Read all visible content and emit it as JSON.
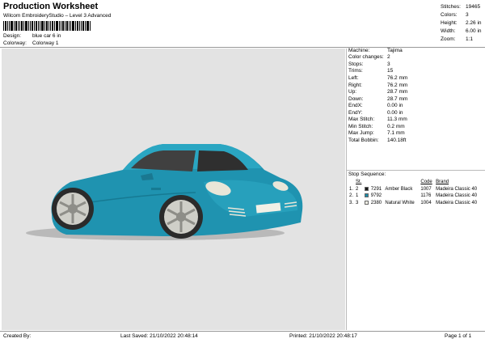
{
  "header": {
    "title": "Production Worksheet",
    "subtitle": "Wilcom EmbroideryStudio – Level 3 Advanced",
    "design_label": "Design:",
    "design_value": "blue car 6 in",
    "colorway_label": "Colorway:",
    "colorway_value": "Colorway 1"
  },
  "top_stats": [
    {
      "label": "Stitches:",
      "value": "19465"
    },
    {
      "label": "Colors:",
      "value": "3"
    },
    {
      "label": "Height:",
      "value": "2.26 in"
    },
    {
      "label": "Width:",
      "value": "6.00 in"
    },
    {
      "label": "Zoom:",
      "value": "1:1"
    }
  ],
  "details": [
    {
      "label": "Machine:",
      "value": "Tajima"
    },
    {
      "label": "Color changes:",
      "value": "2"
    },
    {
      "label": "Stops:",
      "value": "3"
    },
    {
      "label": "Trims:",
      "value": "15"
    },
    {
      "label": "Left:",
      "value": "76.2 mm"
    },
    {
      "label": "Right:",
      "value": "76.2 mm"
    },
    {
      "label": "Up:",
      "value": "28.7 mm"
    },
    {
      "label": "Down:",
      "value": "28.7 mm"
    },
    {
      "label": "EndX:",
      "value": "0.00 in"
    },
    {
      "label": "EndY:",
      "value": "0.00 in"
    },
    {
      "label": "Max Stitch:",
      "value": "11.3 mm"
    },
    {
      "label": "Min Stitch:",
      "value": "0.2 mm"
    },
    {
      "label": "Max Jump:",
      "value": "7.1 mm"
    },
    {
      "label": "Total Bobbin:",
      "value": "140.18ft"
    }
  ],
  "stop_sequence": {
    "title": "Stop Sequence:",
    "headers": {
      "st": "St.",
      "code": "Code",
      "brand": "Brand"
    },
    "rows": [
      {
        "n": "1.",
        "st": "2",
        "color": "#1a1a1a",
        "num": "7291",
        "name": "Amber Black",
        "code": "1007",
        "brand": "Madeira Classic 40"
      },
      {
        "n": "2.",
        "st": "1",
        "color": "#1e8aa6",
        "num": "9792",
        "name": "",
        "code": "1176",
        "brand": "Madeira Classic 40"
      },
      {
        "n": "3.",
        "st": "3",
        "color": "#f2f0e6",
        "num": "2380",
        "name": "Natural White",
        "code": "1004",
        "brand": "Madeira Classic 40"
      }
    ]
  },
  "footer": {
    "created_by": "Created By:",
    "last_saved": "Last Saved: 21/10/2022 20:48:14",
    "printed": "Printed: 21/10/2022 20:48:17",
    "page": "Page 1 of 1"
  }
}
